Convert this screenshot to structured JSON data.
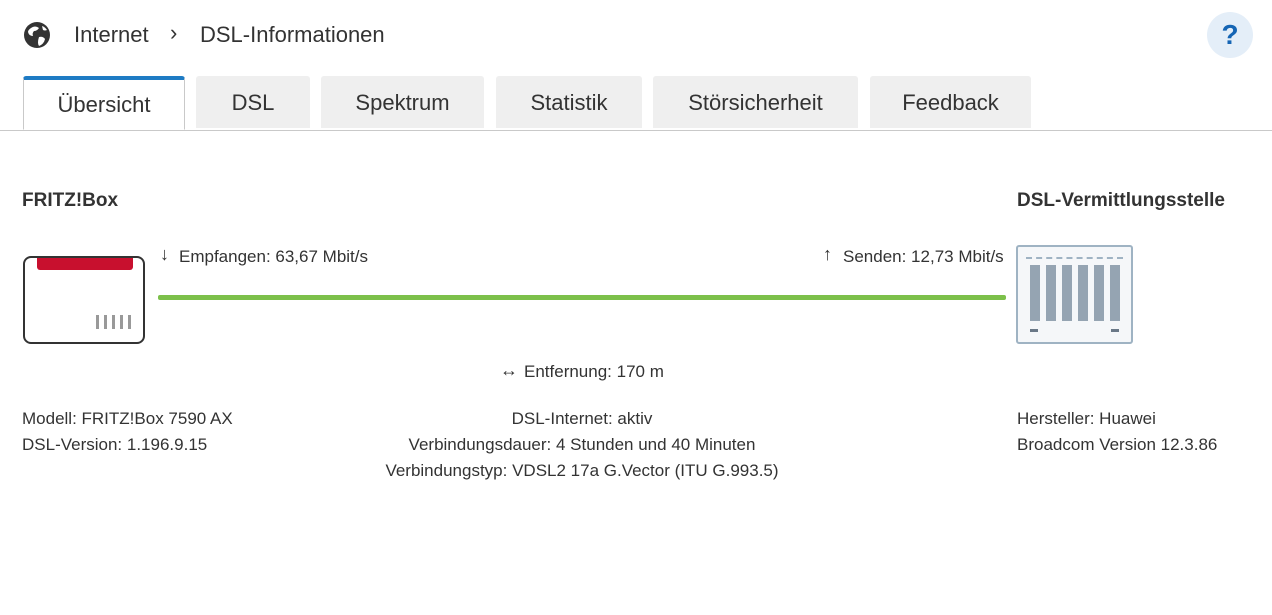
{
  "header": {
    "breadcrumb_1": "Internet",
    "breadcrumb_sep": "›",
    "breadcrumb_2": "DSL-Informationen",
    "help_label": "?"
  },
  "tabs": [
    {
      "label": "Übersicht",
      "active": true
    },
    {
      "label": "DSL"
    },
    {
      "label": "Spektrum"
    },
    {
      "label": "Statistik"
    },
    {
      "label": "Störsicherheit"
    },
    {
      "label": "Feedback"
    }
  ],
  "left": {
    "title": "FRITZ!Box",
    "model": "Modell: FRITZ!Box 7590 AX",
    "dsl_version": "DSL-Version: 1.196.9.15"
  },
  "right": {
    "title": "DSL-Vermittlungsstelle",
    "vendor": "Hersteller: Huawei",
    "chip": "Broadcom Version 12.3.86"
  },
  "link": {
    "down_icon": "↓",
    "down": "Empfangen: 63,67 Mbit/s",
    "up_icon": "↑",
    "up": "Senden: 12,73 Mbit/s",
    "distance_icon": "↔",
    "distance": "Entfernung: 170 m",
    "line_color": "#7cc04a"
  },
  "status": {
    "line1": "DSL-Internet: aktiv",
    "line2": "Verbindungsdauer: 4 Stunden und 40 Minuten",
    "line3": "Verbindungstyp: VDSL2 17a G.Vector (ITU G.993.5)"
  }
}
